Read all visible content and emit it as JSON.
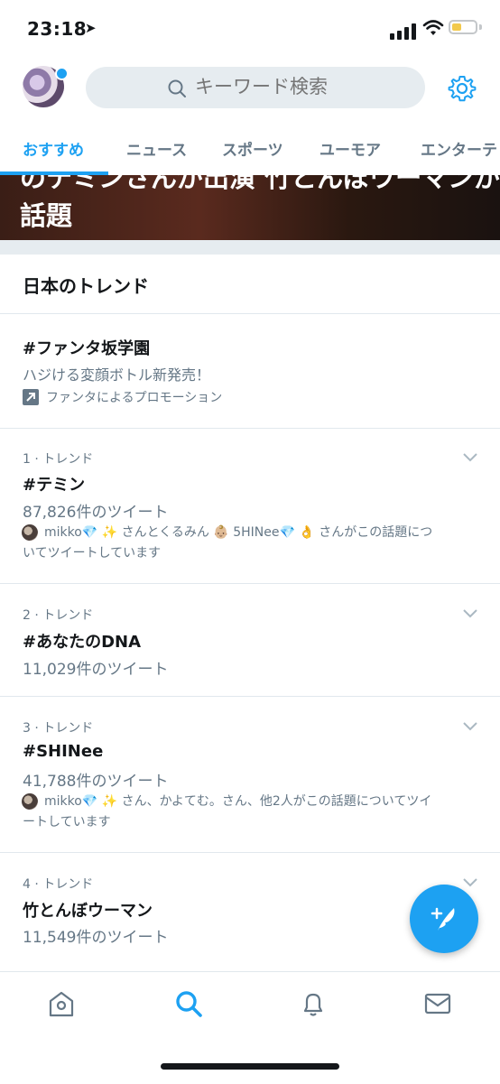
{
  "status_bar": {
    "time": "23:18",
    "location_glyph": "➤"
  },
  "header": {
    "search_placeholder": "キーワード検索"
  },
  "tabs": [
    {
      "label": "おすすめ",
      "active": true
    },
    {
      "label": "ニュース",
      "active": false
    },
    {
      "label": "スポーツ",
      "active": false
    },
    {
      "label": "ユーモア",
      "active": false
    },
    {
      "label": "エンターテ",
      "active": false
    }
  ],
  "hero": {
    "line1": "のテミンさんが出演 竹とんぼウーマンが",
    "line2": "話題"
  },
  "trends_section": {
    "title": "日本のトレンド",
    "promoted": {
      "title": "#ファンタ坂学園",
      "description": "ハジける変顔ボトル新発売！",
      "promo_label": "ファンタによるプロモーション"
    },
    "items": [
      {
        "meta": "1 · トレンド",
        "title": "#テミン",
        "count": "87,826件のツイート",
        "context_line1": "mikko💎 ✨ さんとくるみん 👶🏼 5HINee💎 👌 さんがこの話題につ",
        "context_line2": "いてツイートしています"
      },
      {
        "meta": "2 · トレンド",
        "title": "#あなたのDNA",
        "count": "11,029件のツイート"
      },
      {
        "meta": "3 · トレンド",
        "title": "#SHINee",
        "count": "41,788件のツイート",
        "context_line1": "mikko💎 ✨ さん、かよてむ。さん、他2人がこの話題についてツイ",
        "context_line2": "ートしています"
      },
      {
        "meta": "4 · トレンド",
        "title": "竹とんぼウーマン",
        "count": "11,549件のツイート"
      }
    ]
  },
  "colors": {
    "accent": "#1da1f2",
    "text": "#14171a",
    "muted": "#657786",
    "divider": "#e1e8ed"
  },
  "bottom_nav": [
    "home-icon",
    "search-icon",
    "notifications-icon",
    "messages-icon"
  ]
}
